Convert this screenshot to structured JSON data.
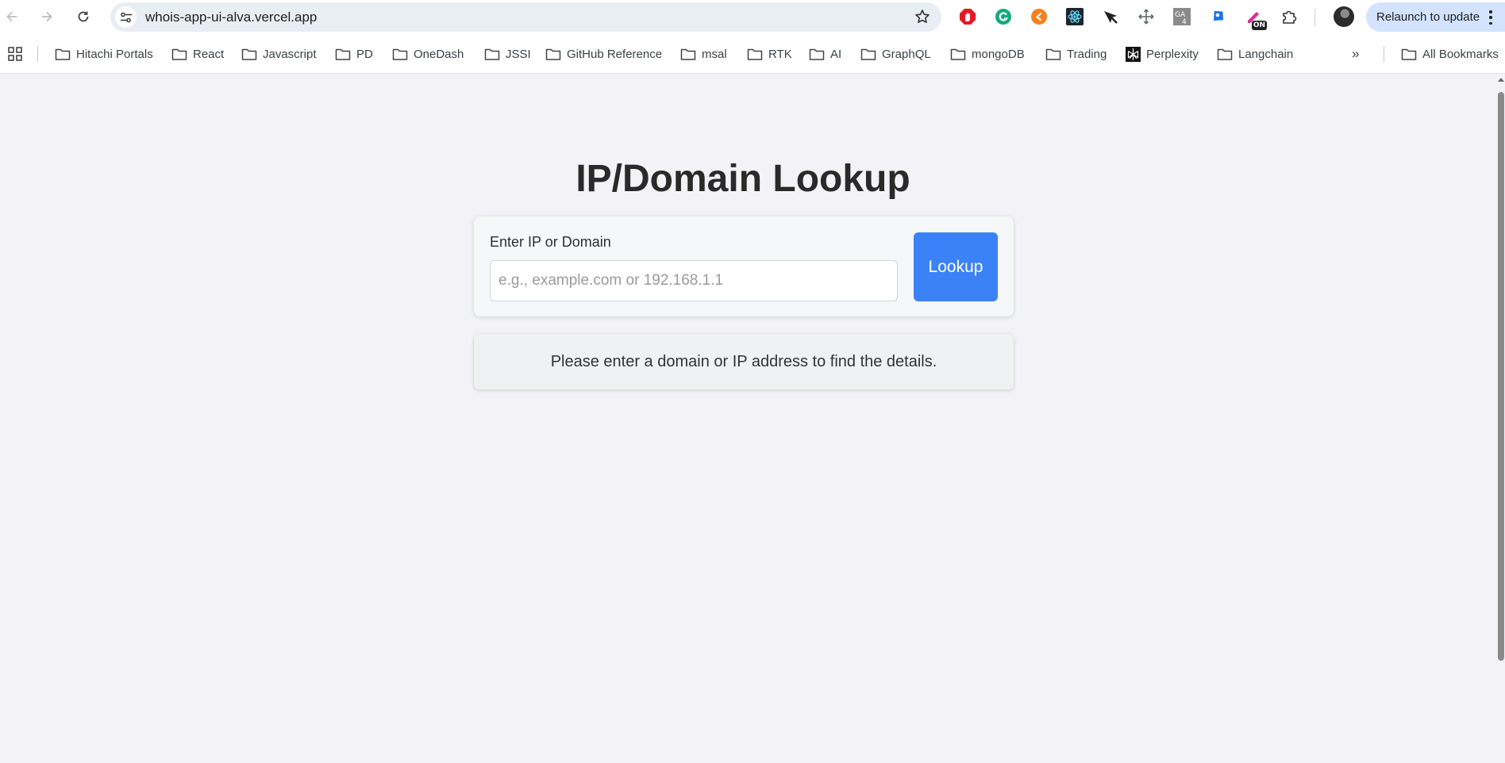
{
  "browser": {
    "url": "whois-app-ui-alva.vercel.app",
    "relaunch_label": "Relaunch to update",
    "extensions": [
      {
        "name": "adblock-icon",
        "color": "#e31b23"
      },
      {
        "name": "grammarly-icon",
        "color": "#15a97f"
      },
      {
        "name": "orange-extension-icon",
        "color": "#f4801f"
      },
      {
        "name": "react-devtools-icon",
        "color": "#61dafb"
      },
      {
        "name": "black-extension-icon",
        "color": "#202124"
      },
      {
        "name": "move-cursor-icon",
        "color": "#5f6368"
      },
      {
        "name": "ga4-icon",
        "color": "#7a7a7a"
      },
      {
        "name": "tag-assistant-icon",
        "color": "#1a73e8"
      },
      {
        "name": "on-toggle-extension-icon",
        "badge": "ON"
      },
      {
        "name": "extensions-puzzle-icon",
        "color": "#5f6368"
      }
    ]
  },
  "bookmarks": {
    "items": [
      {
        "label": "Hitachi Portals",
        "icon": "folder-icon"
      },
      {
        "label": "React",
        "icon": "folder-icon"
      },
      {
        "label": "Javascript",
        "icon": "folder-icon"
      },
      {
        "label": "PD",
        "icon": "folder-icon"
      },
      {
        "label": "OneDash",
        "icon": "folder-icon"
      },
      {
        "label": "JSSI",
        "icon": "folder-icon"
      },
      {
        "label": "GitHub Reference",
        "icon": "folder-icon"
      },
      {
        "label": "msal",
        "icon": "folder-icon"
      },
      {
        "label": "RTK",
        "icon": "folder-icon"
      },
      {
        "label": "AI",
        "icon": "folder-icon"
      },
      {
        "label": "GraphQL",
        "icon": "folder-icon"
      },
      {
        "label": "mongoDB",
        "icon": "folder-icon"
      },
      {
        "label": "Trading",
        "icon": "folder-icon"
      },
      {
        "label": "Perplexity",
        "icon": "perplexity-icon"
      },
      {
        "label": "Langchain",
        "icon": "folder-icon"
      }
    ],
    "overflow": "»",
    "all_bookmarks": "All Bookmarks"
  },
  "page": {
    "title": "IP/Domain Lookup",
    "field_label": "Enter IP or Domain",
    "input_value": "",
    "input_placeholder": "e.g., example.com or 192.168.1.1",
    "button_label": "Lookup",
    "info_message": "Please enter a domain or IP address to find the details.",
    "accent_color": "#3b82f6"
  }
}
